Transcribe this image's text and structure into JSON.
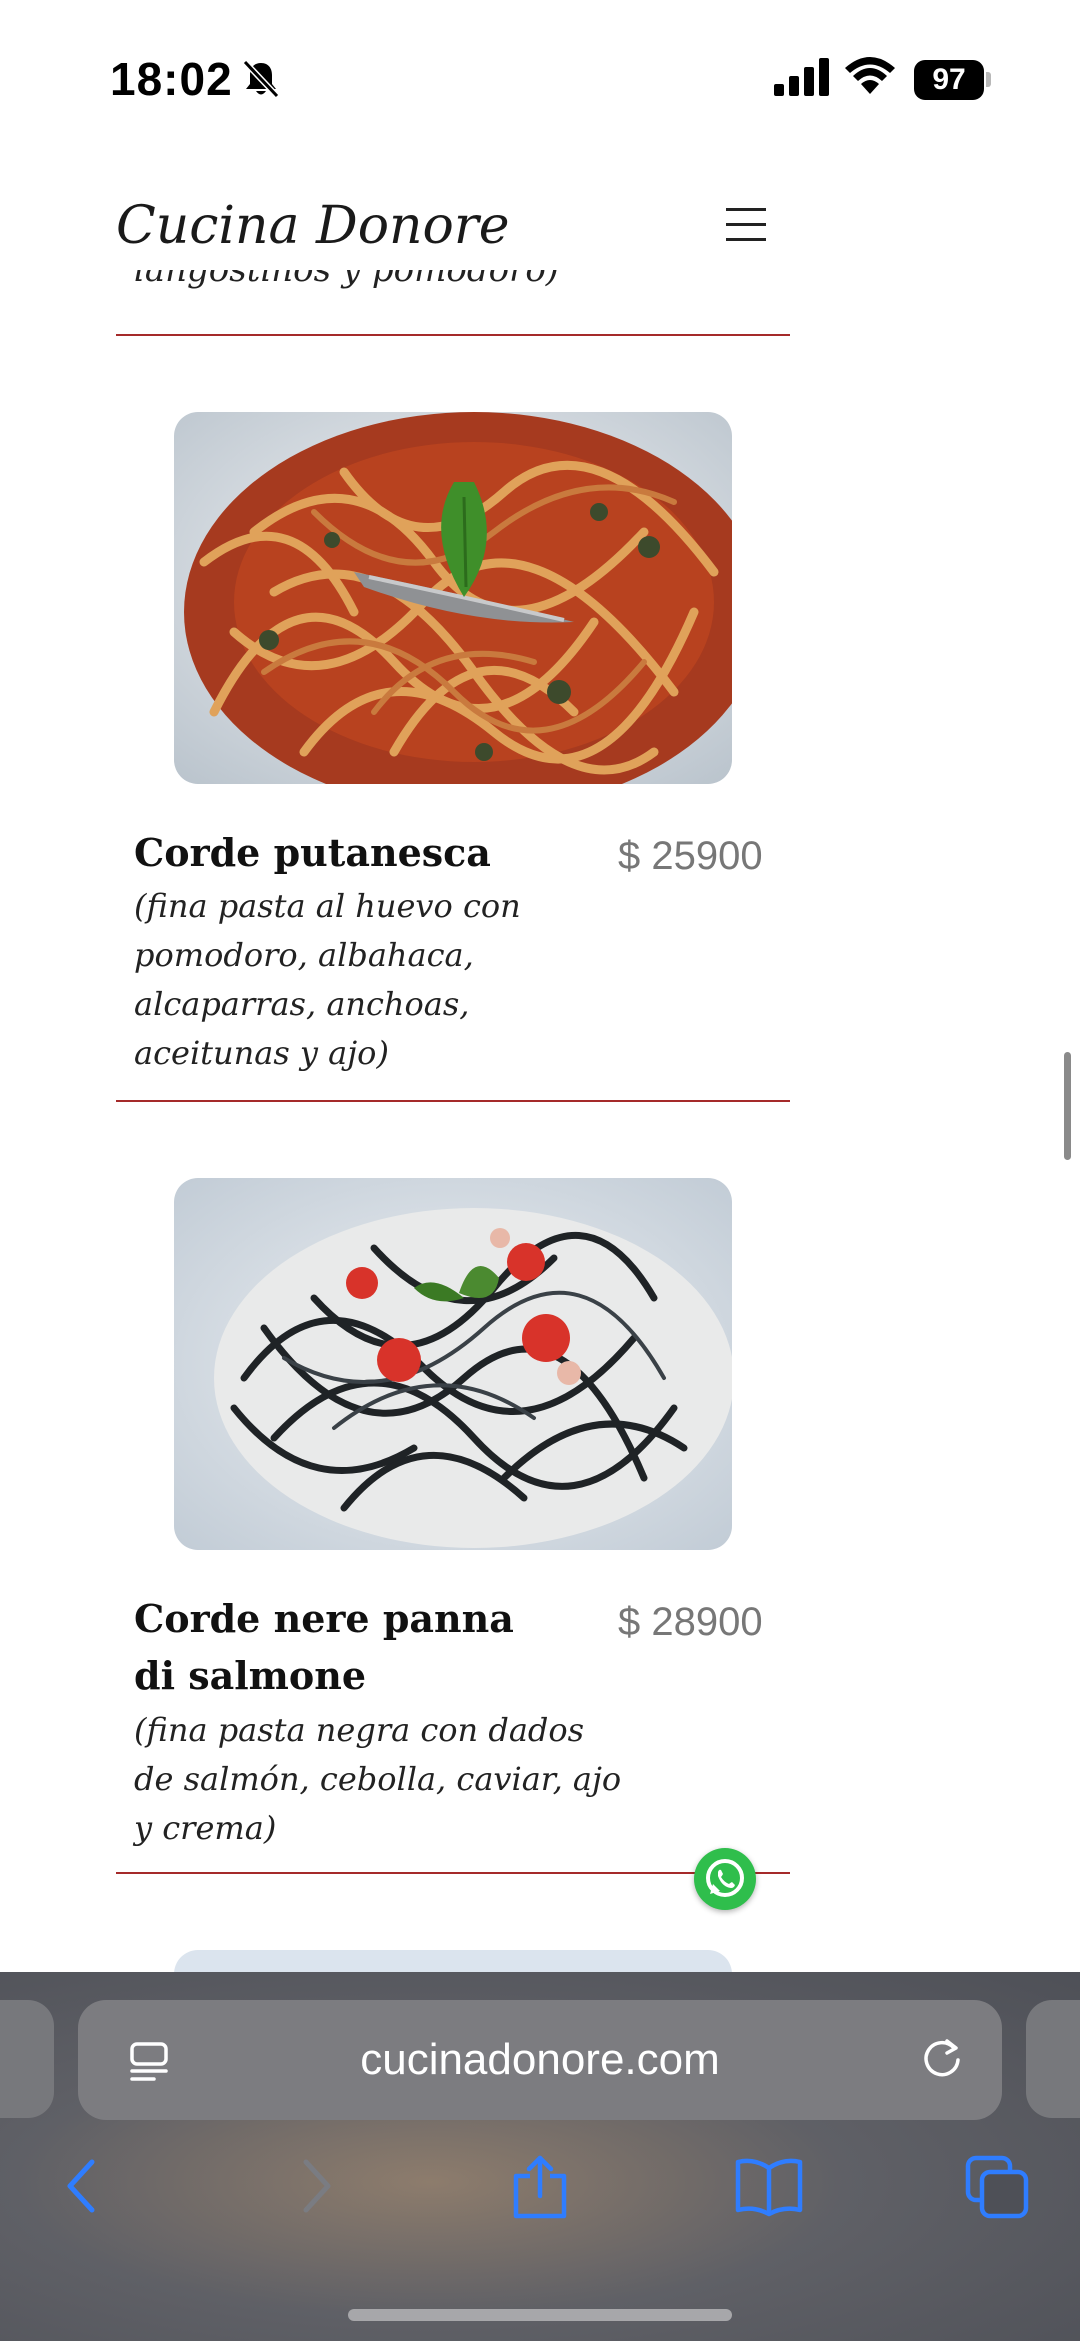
{
  "status_bar": {
    "time": "18:02",
    "battery": "97"
  },
  "header": {
    "site_title": "Cucina Donore"
  },
  "previous_item": {
    "desc_tail": "langostinos y pomodoro)"
  },
  "menu_items": [
    {
      "name": "Corde putanesca",
      "price": "$ 25900",
      "description": "(fina pasta al huevo con pomodoro, albahaca, alcaparras, anchoas, aceitunas y ajo)"
    },
    {
      "name": "Corde nere panna di salmone",
      "price": "$ 28900",
      "description": "(fina pasta negra con dados de salmón, cebolla, caviar, ajo y crema)"
    }
  ],
  "browser": {
    "url": "cucinadonore.com"
  },
  "colors": {
    "divider": "#a52a2a",
    "price": "#777777",
    "whatsapp": "#2fbe4c",
    "browser_accent": "#2f7dff"
  }
}
